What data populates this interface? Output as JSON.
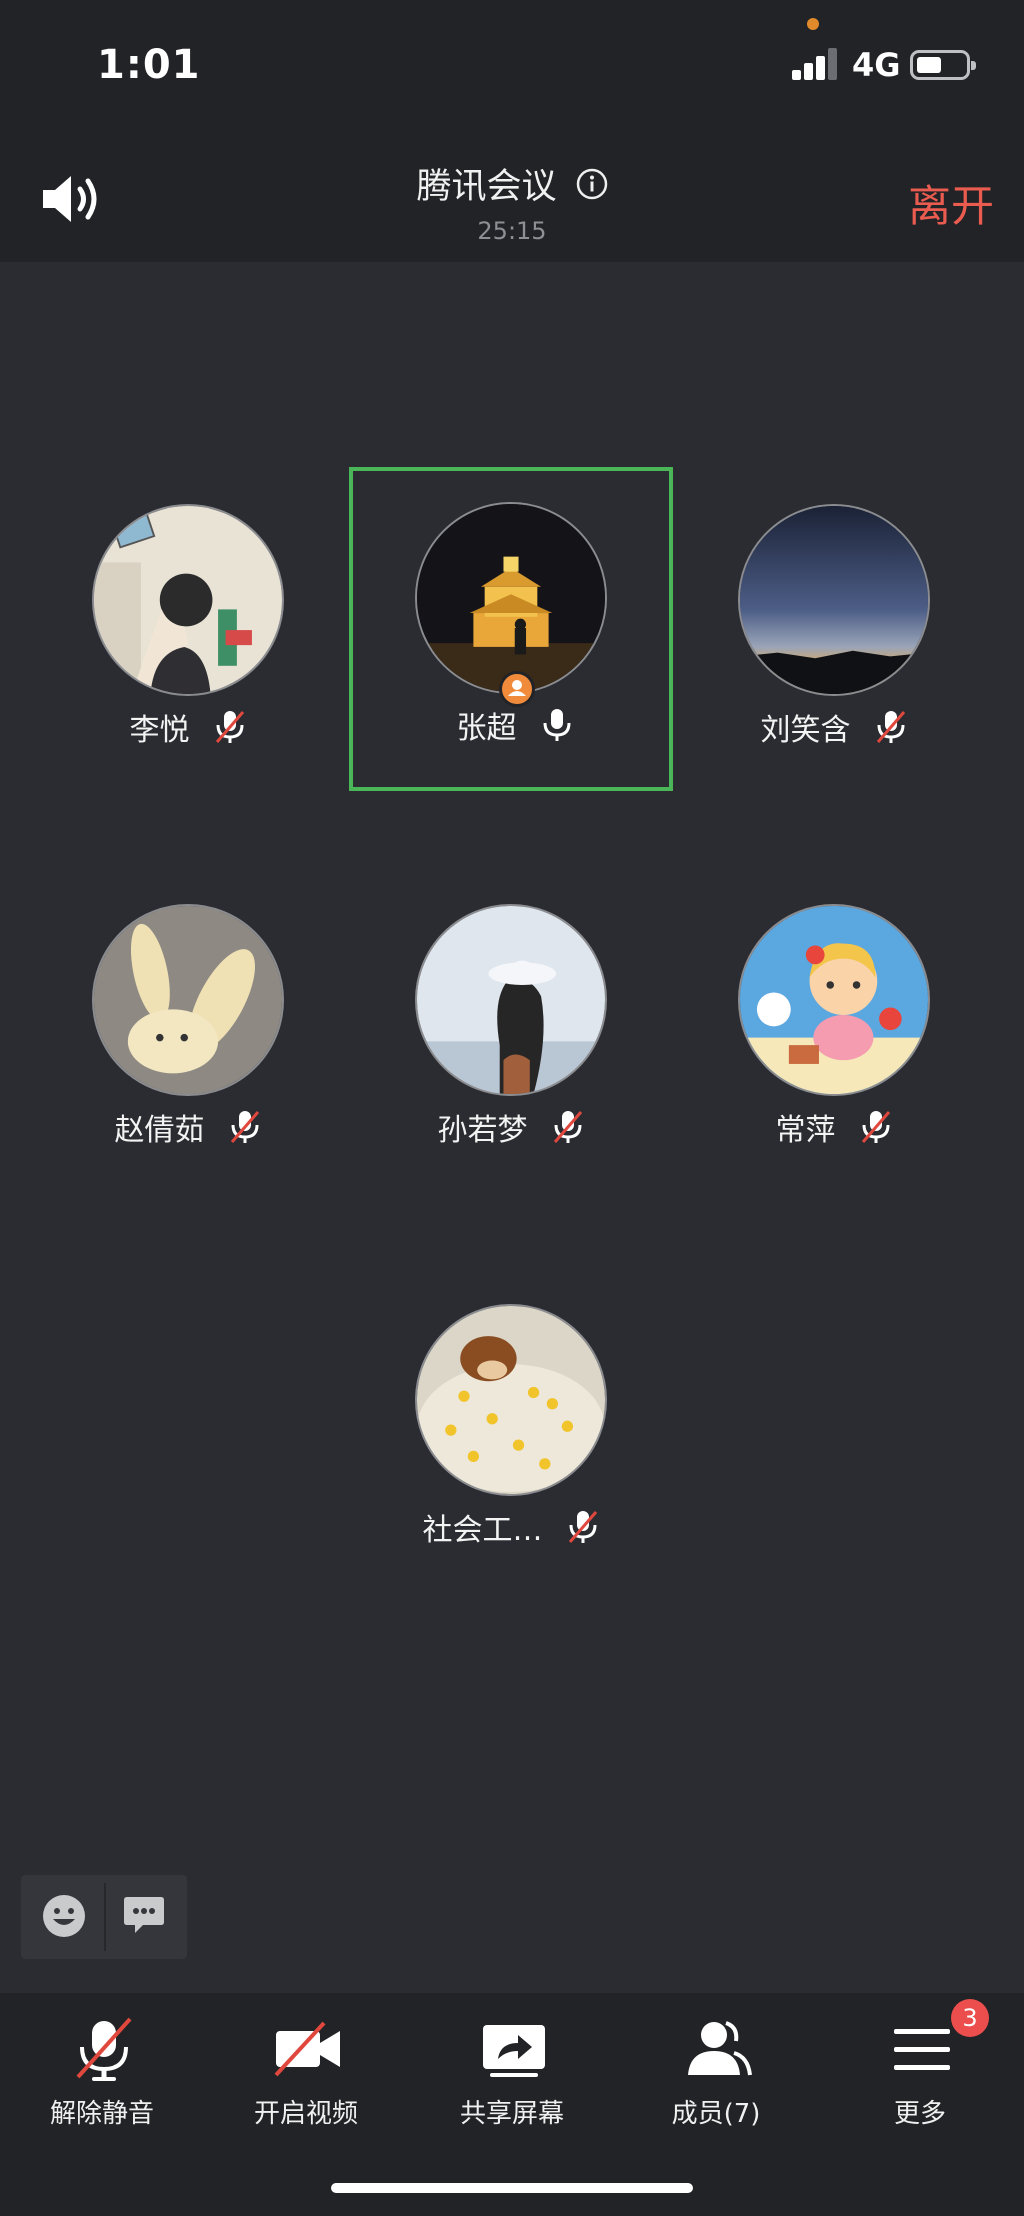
{
  "status_bar": {
    "time": "1:01",
    "network": "4G"
  },
  "header": {
    "title": "腾讯会议",
    "duration": "25:15",
    "leave_label": "离开"
  },
  "participants": [
    {
      "name": "李悦",
      "mic": "muted"
    },
    {
      "name": "张超",
      "mic": "on",
      "active_speaker": true,
      "host": true
    },
    {
      "name": "刘笑含",
      "mic": "muted"
    },
    {
      "name": "赵倩茹",
      "mic": "muted"
    },
    {
      "name": "孙若梦",
      "mic": "muted"
    },
    {
      "name": "常萍",
      "mic": "muted"
    },
    {
      "name": "社会工…",
      "mic": "muted"
    }
  ],
  "toolbar": {
    "unmute_label": "解除静音",
    "video_label": "开启视频",
    "share_label": "共享屏幕",
    "members_label": "成员(7)",
    "more_label": "更多",
    "more_badge": "3"
  },
  "colors": {
    "background": "#2a2c31",
    "bar": "#222326",
    "leave": "#ea5b50",
    "active_border": "#4ab657",
    "mute_slash": "#e0483e",
    "badge": "#ec4d4d",
    "host_badge": "#ef8b3b"
  },
  "icons": {
    "speaker": "speaker-icon",
    "info": "info-icon",
    "mic_on": "mic-icon",
    "mic_muted": "mic-muted-icon",
    "emoji": "emoji-icon",
    "chat": "chat-bubble-icon",
    "video_off": "video-off-icon",
    "share": "share-screen-icon",
    "members": "members-icon",
    "more": "menu-icon"
  }
}
